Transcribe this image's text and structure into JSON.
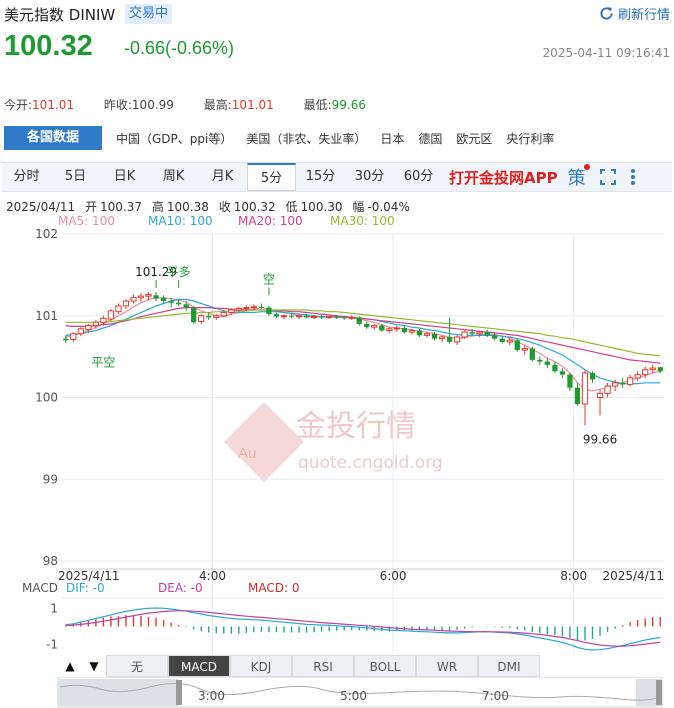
{
  "header": {
    "title": "美元指数 DINIW",
    "status_badge": "交易中",
    "refresh_label": "刷新行情",
    "price": "100.32",
    "change": "-0.66(-0.66%)",
    "timestamp": "2025-04-11 09:16:41"
  },
  "stats": {
    "open_label": "今开:",
    "open": "101.01",
    "prev_close_label": "昨收:",
    "prev_close": "100.99",
    "high_label": "最高:",
    "high": "101.01",
    "low_label": "最低:",
    "low": "99.66"
  },
  "category_tabs": [
    "各国数据",
    "中国（GDP、ppi等）",
    "美国（非农、失业率）",
    "日本",
    "德国",
    "欧元区",
    "央行利率"
  ],
  "period_tabs": [
    "分时",
    "5日",
    "日K",
    "周K",
    "月K",
    "5分",
    "15分",
    "30分",
    "60分"
  ],
  "active_period": "5分",
  "app_link": "打开金投网APP",
  "strategy_label": "策",
  "ohlc_line": {
    "date": "2025/04/11",
    "open_label": "开",
    "open": "100.37",
    "high_label": "高",
    "high": "100.38",
    "close_label": "收",
    "close": "100.32",
    "low_label": "低",
    "low": "100.30",
    "amp_label": "幅",
    "amp": "-0.04%"
  },
  "ma_legend": [
    {
      "label": "MA5: 100",
      "color": "#f08ca0"
    },
    {
      "label": "MA10: 100",
      "color": "#29a8d8"
    },
    {
      "label": "MA20: 100",
      "color": "#d0408a"
    },
    {
      "label": "MA30: 100",
      "color": "#98b830"
    }
  ],
  "watermark": {
    "brand": "金投行情",
    "url": "quote.cngold.org",
    "logo_text": "Au"
  },
  "chart_data": {
    "type": "candlestick",
    "y_ticks": [
      "102",
      "101",
      "100",
      "99",
      "98"
    ],
    "ylim": [
      98,
      102
    ],
    "x_ticks": [
      {
        "label": "2025/4/11",
        "slot": 0
      },
      {
        "label": "4:00",
        "slot": 20
      },
      {
        "label": "6:00",
        "slot": 44
      },
      {
        "label": "8:00",
        "slot": 68
      },
      {
        "label": "2025/4/11",
        "slot": 80
      }
    ],
    "annotations": [
      {
        "text": "101.29",
        "slot": 12,
        "value": 101.29
      },
      {
        "text": "平多",
        "slot": 15,
        "value": 101.29
      },
      {
        "text": "平空",
        "slot": 5,
        "value": 100.6
      },
      {
        "text": "空",
        "slot": 27,
        "value": 101.2
      },
      {
        "text": "99.66",
        "slot": 71,
        "value": 99.66
      }
    ],
    "candles": [
      [
        100.72,
        100.76,
        100.67,
        100.7
      ],
      [
        100.71,
        100.8,
        100.68,
        100.78
      ],
      [
        100.78,
        100.86,
        100.75,
        100.84
      ],
      [
        100.83,
        100.9,
        100.79,
        100.88
      ],
      [
        100.88,
        100.95,
        100.84,
        100.92
      ],
      [
        100.92,
        101.0,
        100.88,
        100.97
      ],
      [
        100.96,
        101.08,
        100.94,
        101.06
      ],
      [
        101.05,
        101.15,
        101.02,
        101.12
      ],
      [
        101.12,
        101.2,
        101.08,
        101.18
      ],
      [
        101.18,
        101.26,
        101.15,
        101.22
      ],
      [
        101.22,
        101.28,
        101.17,
        101.24
      ],
      [
        101.24,
        101.29,
        101.19,
        101.26
      ],
      [
        101.25,
        101.29,
        101.18,
        101.21
      ],
      [
        101.22,
        101.25,
        101.15,
        101.18
      ],
      [
        101.18,
        101.22,
        101.1,
        101.16
      ],
      [
        101.16,
        101.2,
        101.12,
        101.14
      ],
      [
        101.14,
        101.18,
        101.06,
        101.1
      ],
      [
        101.1,
        101.12,
        100.9,
        100.92
      ],
      [
        100.93,
        101.02,
        100.9,
        101.0
      ],
      [
        101.0,
        101.04,
        100.95,
        100.98
      ],
      [
        100.98,
        101.02,
        100.95,
        101.0
      ],
      [
        101.0,
        101.06,
        100.98,
        101.04
      ],
      [
        101.04,
        101.09,
        101.01,
        101.07
      ],
      [
        101.07,
        101.11,
        101.04,
        101.09
      ],
      [
        101.09,
        101.13,
        101.06,
        101.1
      ],
      [
        101.1,
        101.14,
        101.07,
        101.11
      ],
      [
        101.11,
        101.15,
        101.08,
        101.1
      ],
      [
        101.1,
        101.12,
        101.0,
        101.02
      ],
      [
        101.02,
        101.04,
        100.97,
        100.99
      ],
      [
        100.99,
        101.02,
        100.96,
        101.0
      ],
      [
        101.0,
        101.03,
        100.97,
        100.99
      ],
      [
        100.99,
        101.02,
        100.96,
        101.0
      ],
      [
        101.0,
        101.02,
        100.97,
        100.98
      ],
      [
        100.98,
        101.01,
        100.96,
        100.99
      ],
      [
        100.99,
        101.01,
        100.96,
        100.98
      ],
      [
        100.98,
        101.0,
        100.96,
        100.99
      ],
      [
        100.99,
        101.01,
        100.96,
        100.98
      ],
      [
        100.98,
        101.0,
        100.95,
        100.97
      ],
      [
        100.97,
        101.0,
        100.95,
        100.98
      ],
      [
        100.98,
        100.99,
        100.88,
        100.9
      ],
      [
        100.9,
        100.93,
        100.84,
        100.86
      ],
      [
        100.86,
        100.9,
        100.83,
        100.88
      ],
      [
        100.88,
        100.9,
        100.8,
        100.82
      ],
      [
        100.82,
        100.86,
        100.79,
        100.84
      ],
      [
        100.84,
        100.88,
        100.8,
        100.85
      ],
      [
        100.85,
        100.87,
        100.78,
        100.8
      ],
      [
        100.8,
        100.84,
        100.77,
        100.82
      ],
      [
        100.82,
        100.84,
        100.74,
        100.76
      ],
      [
        100.76,
        100.8,
        100.73,
        100.78
      ],
      [
        100.78,
        100.8,
        100.7,
        100.72
      ],
      [
        100.72,
        100.76,
        100.68,
        100.74
      ],
      [
        100.74,
        100.98,
        100.66,
        100.68
      ],
      [
        100.68,
        100.76,
        100.64,
        100.74
      ],
      [
        100.74,
        100.82,
        100.72,
        100.8
      ],
      [
        100.8,
        100.84,
        100.76,
        100.78
      ],
      [
        100.78,
        100.82,
        100.74,
        100.8
      ],
      [
        100.8,
        100.83,
        100.74,
        100.76
      ],
      [
        100.76,
        100.79,
        100.7,
        100.72
      ],
      [
        100.72,
        100.76,
        100.66,
        100.68
      ],
      [
        100.68,
        100.74,
        100.64,
        100.7
      ],
      [
        100.7,
        100.72,
        100.56,
        100.58
      ],
      [
        100.58,
        100.64,
        100.52,
        100.6
      ],
      [
        100.6,
        100.62,
        100.44,
        100.46
      ],
      [
        100.46,
        100.5,
        100.4,
        100.44
      ],
      [
        100.44,
        100.48,
        100.36,
        100.4
      ],
      [
        100.4,
        100.44,
        100.3,
        100.32
      ],
      [
        100.32,
        100.36,
        100.24,
        100.28
      ],
      [
        100.28,
        100.3,
        100.08,
        100.12
      ],
      [
        100.12,
        100.18,
        99.9,
        99.92
      ],
      [
        99.92,
        100.34,
        99.66,
        100.3
      ],
      [
        100.3,
        100.32,
        100.18,
        100.22
      ],
      [
        100.0,
        100.1,
        99.78,
        100.05
      ],
      [
        100.05,
        100.18,
        100.0,
        100.14
      ],
      [
        100.14,
        100.22,
        100.08,
        100.18
      ],
      [
        100.18,
        100.24,
        100.12,
        100.16
      ],
      [
        100.16,
        100.28,
        100.14,
        100.24
      ],
      [
        100.24,
        100.32,
        100.2,
        100.28
      ],
      [
        100.28,
        100.38,
        100.24,
        100.34
      ],
      [
        100.34,
        100.4,
        100.3,
        100.36
      ],
      [
        100.37,
        100.38,
        100.3,
        100.32
      ]
    ],
    "ma_lines": [
      {
        "name": "MA5",
        "color": "#f08ca0",
        "values": [
          100.74,
          100.76,
          100.79,
          100.82,
          100.86,
          100.9,
          100.95,
          101.0,
          101.05,
          101.11,
          101.16,
          101.2,
          101.22,
          101.22,
          101.21,
          101.19,
          101.17,
          101.1,
          101.06,
          101.03,
          101.0,
          100.99,
          101.02,
          101.04,
          101.06,
          101.08,
          101.1,
          101.08,
          101.06,
          101.04,
          101.02,
          101.0,
          100.99,
          100.99,
          100.99,
          100.99,
          100.98,
          100.98,
          100.98,
          100.96,
          100.94,
          100.92,
          100.89,
          100.86,
          100.85,
          100.84,
          100.83,
          100.81,
          100.8,
          100.78,
          100.76,
          100.74,
          100.72,
          100.73,
          100.75,
          100.77,
          100.78,
          100.77,
          100.75,
          100.73,
          100.68,
          100.64,
          100.59,
          100.54,
          100.48,
          100.44,
          100.38,
          100.3,
          100.18,
          100.1,
          100.08,
          100.1,
          100.12,
          100.16,
          100.18,
          100.21,
          100.24,
          100.27,
          100.3,
          100.32
        ]
      },
      {
        "name": "MA10",
        "color": "#29a8d8",
        "values": [
          100.76,
          100.77,
          100.78,
          100.8,
          100.82,
          100.85,
          100.88,
          100.92,
          100.96,
          101.0,
          101.04,
          101.08,
          101.12,
          101.15,
          101.18,
          101.2,
          101.2,
          101.18,
          101.15,
          101.12,
          101.09,
          101.06,
          101.05,
          101.04,
          101.04,
          101.04,
          101.05,
          101.05,
          101.05,
          101.04,
          101.03,
          101.02,
          101.01,
          101.0,
          100.99,
          100.99,
          100.99,
          100.99,
          100.98,
          100.97,
          100.96,
          100.95,
          100.93,
          100.91,
          100.89,
          100.88,
          100.86,
          100.85,
          100.83,
          100.82,
          100.8,
          100.78,
          100.77,
          100.76,
          100.76,
          100.76,
          100.76,
          100.76,
          100.75,
          100.74,
          100.72,
          100.7,
          100.67,
          100.64,
          100.6,
          100.56,
          100.52,
          100.46,
          100.4,
          100.34,
          100.28,
          100.24,
          100.21,
          100.19,
          100.17,
          100.17,
          100.17,
          100.18,
          100.18,
          100.18
        ]
      },
      {
        "name": "MA20",
        "color": "#d0408a",
        "values": [
          100.88,
          100.87,
          100.87,
          100.87,
          100.88,
          100.89,
          100.9,
          100.92,
          100.94,
          100.96,
          100.99,
          101.01,
          101.03,
          101.05,
          101.07,
          101.09,
          101.1,
          101.1,
          101.1,
          101.1,
          101.09,
          101.09,
          101.08,
          101.08,
          101.07,
          101.07,
          101.07,
          101.07,
          101.06,
          101.06,
          101.05,
          101.05,
          101.04,
          101.03,
          101.02,
          101.01,
          101.0,
          100.99,
          100.98,
          100.97,
          100.96,
          100.95,
          100.94,
          100.93,
          100.92,
          100.91,
          100.9,
          100.89,
          100.88,
          100.87,
          100.86,
          100.85,
          100.84,
          100.83,
          100.82,
          100.81,
          100.8,
          100.79,
          100.78,
          100.77,
          100.76,
          100.74,
          100.72,
          100.7,
          100.68,
          100.66,
          100.64,
          100.62,
          100.6,
          100.58,
          100.56,
          100.54,
          100.52,
          100.5,
          100.48,
          100.46,
          100.45,
          100.44,
          100.43,
          100.42
        ]
      },
      {
        "name": "MA30",
        "color": "#98b830",
        "values": [
          100.92,
          100.92,
          100.92,
          100.92,
          100.92,
          100.93,
          100.93,
          100.94,
          100.95,
          100.96,
          100.97,
          100.98,
          100.99,
          101.0,
          101.01,
          101.02,
          101.03,
          101.03,
          101.04,
          101.04,
          101.05,
          101.05,
          101.06,
          101.06,
          101.06,
          101.07,
          101.07,
          101.07,
          101.07,
          101.07,
          101.07,
          101.07,
          101.07,
          101.06,
          101.06,
          101.05,
          101.05,
          101.04,
          101.03,
          101.02,
          101.01,
          101.0,
          100.99,
          100.98,
          100.97,
          100.96,
          100.95,
          100.94,
          100.93,
          100.92,
          100.91,
          100.9,
          100.89,
          100.88,
          100.87,
          100.86,
          100.85,
          100.84,
          100.83,
          100.82,
          100.81,
          100.8,
          100.79,
          100.78,
          100.76,
          100.75,
          100.73,
          100.72,
          100.7,
          100.68,
          100.66,
          100.64,
          100.62,
          100.6,
          100.58,
          100.56,
          100.54,
          100.53,
          100.52,
          100.51
        ]
      }
    ],
    "macd": {
      "legend": {
        "name": "MACD",
        "dif_label": "DIF: -0",
        "dea_label": "DEA: -0",
        "macd_label": "MACD: 0"
      },
      "y_ticks": [
        "1",
        "-1"
      ],
      "ylim": [
        -1.6,
        1.6
      ],
      "dif": [
        0.1,
        0.15,
        0.25,
        0.35,
        0.45,
        0.55,
        0.65,
        0.75,
        0.85,
        0.92,
        0.98,
        1.02,
        1.04,
        1.02,
        0.98,
        0.92,
        0.86,
        0.78,
        0.7,
        0.62,
        0.56,
        0.5,
        0.46,
        0.42,
        0.4,
        0.38,
        0.36,
        0.32,
        0.28,
        0.24,
        0.2,
        0.16,
        0.12,
        0.1,
        0.08,
        0.06,
        0.04,
        0.02,
        0.0,
        -0.04,
        -0.08,
        -0.12,
        -0.16,
        -0.2,
        -0.22,
        -0.24,
        -0.26,
        -0.28,
        -0.3,
        -0.32,
        -0.34,
        -0.36,
        -0.36,
        -0.34,
        -0.32,
        -0.3,
        -0.3,
        -0.32,
        -0.34,
        -0.36,
        -0.42,
        -0.48,
        -0.56,
        -0.64,
        -0.72,
        -0.8,
        -0.9,
        -1.02,
        -1.18,
        -1.28,
        -1.32,
        -1.3,
        -1.24,
        -1.16,
        -1.06,
        -0.96,
        -0.86,
        -0.76,
        -0.68,
        -0.62
      ],
      "dea": [
        0.05,
        0.08,
        0.12,
        0.17,
        0.23,
        0.3,
        0.37,
        0.45,
        0.53,
        0.61,
        0.68,
        0.75,
        0.8,
        0.84,
        0.87,
        0.88,
        0.88,
        0.86,
        0.83,
        0.79,
        0.75,
        0.7,
        0.66,
        0.62,
        0.58,
        0.54,
        0.51,
        0.48,
        0.44,
        0.41,
        0.37,
        0.33,
        0.29,
        0.26,
        0.22,
        0.19,
        0.16,
        0.13,
        0.1,
        0.07,
        0.04,
        0.01,
        -0.03,
        -0.06,
        -0.09,
        -0.12,
        -0.15,
        -0.17,
        -0.19,
        -0.21,
        -0.23,
        -0.25,
        -0.27,
        -0.28,
        -0.29,
        -0.29,
        -0.29,
        -0.3,
        -0.31,
        -0.32,
        -0.34,
        -0.37,
        -0.41,
        -0.45,
        -0.5,
        -0.56,
        -0.62,
        -0.7,
        -0.79,
        -0.89,
        -0.97,
        -1.04,
        -1.08,
        -1.1,
        -1.1,
        -1.08,
        -1.04,
        -0.99,
        -0.94,
        -0.89
      ]
    }
  },
  "indicator_tabs": [
    "无",
    "MACD",
    "KDJ",
    "RSI",
    "BOLL",
    "WR",
    "DMI"
  ],
  "active_indicator": "MACD",
  "navigator": {
    "ticks": [
      "3:00",
      "5:00",
      "7:00"
    ]
  }
}
